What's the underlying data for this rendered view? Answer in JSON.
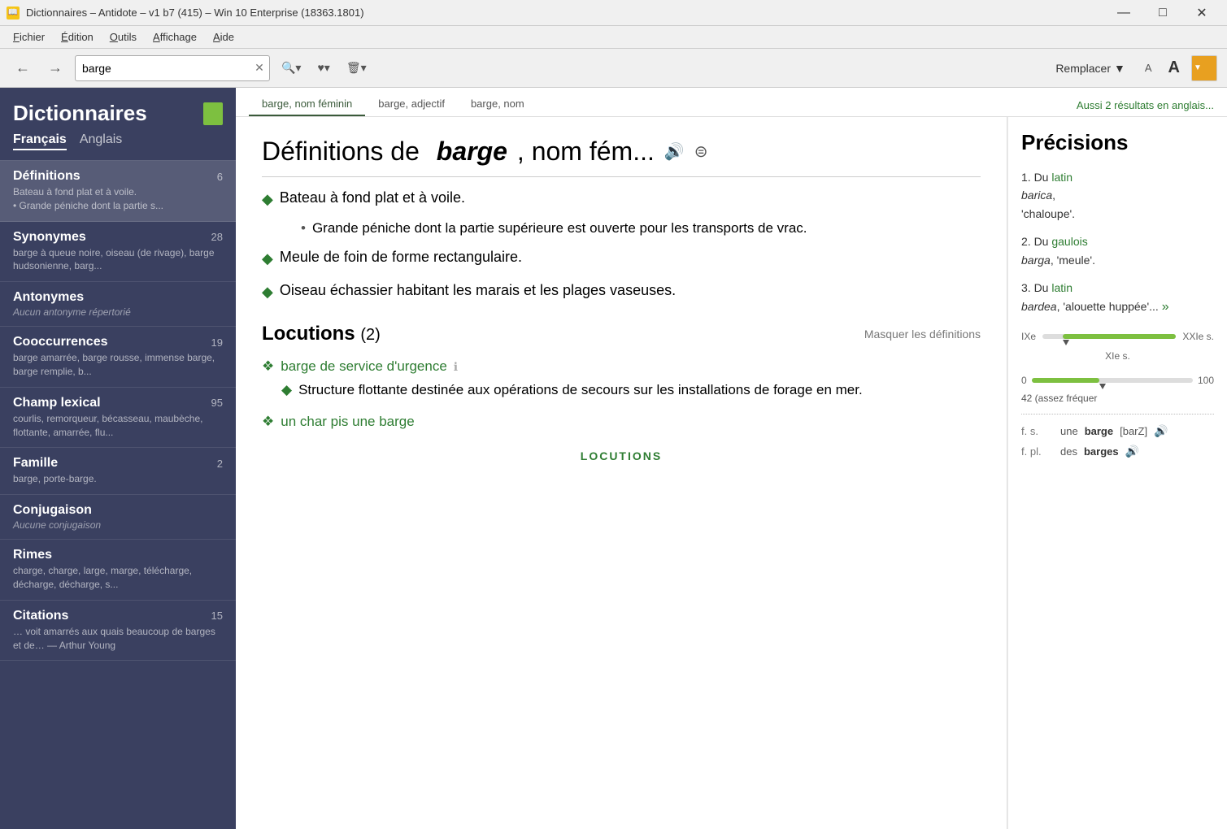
{
  "window": {
    "title": "Dictionnaires – Antidote – v1 b7 (415) – Win 10 Enterprise (18363.1801)",
    "icon": "📖"
  },
  "titlebar": {
    "minimize": "—",
    "maximize": "□",
    "close": "✕"
  },
  "menu": {
    "fichier": "Fichier",
    "edition": "Édition",
    "outils": "Outils",
    "affichage": "Affichage",
    "aide": "Aide"
  },
  "toolbar": {
    "back": "←",
    "forward": "→",
    "search_value": "barge",
    "search_clear": "✕",
    "search_icon": "🔍",
    "favorites_icon": "♥",
    "history_icon": "🗑",
    "remplacer": "Remplacer",
    "font_small": "A",
    "font_large": "A",
    "dropdown": "▼"
  },
  "sidebar": {
    "title": "Dictionnaires",
    "languages": [
      "Français",
      "Anglais"
    ],
    "active_language": "Français",
    "sections": [
      {
        "id": "definitions",
        "title": "Définitions",
        "count": 6,
        "preview": "Bateau à fond plat et à voile.\n• Grande péniche dont la partie s...",
        "active": true
      },
      {
        "id": "synonymes",
        "title": "Synonymes",
        "count": 28,
        "preview": "barge à queue noire, oiseau (de rivage), barge hudsonienne, barg..."
      },
      {
        "id": "antonymes",
        "title": "Antonymes",
        "count": null,
        "no_data": "Aucun antonyme répertorié"
      },
      {
        "id": "cooccurrences",
        "title": "Cooccurrences",
        "count": 19,
        "preview": "barge amarrée, barge rousse, immense barge, barge remplie, b..."
      },
      {
        "id": "champ_lexical",
        "title": "Champ lexical",
        "count": 95,
        "preview": "courlis, remorqueur, bécasseau, maubèche, flottante, amarrée, flu..."
      },
      {
        "id": "famille",
        "title": "Famille",
        "count": 2,
        "preview": "barge, porte-barge."
      },
      {
        "id": "conjugaison",
        "title": "Conjugaison",
        "count": null,
        "no_data": "Aucune conjugaison"
      },
      {
        "id": "rimes",
        "title": "Rimes",
        "count": null,
        "preview": "charge, charge, large, marge, télécharge, décharge, décharge, s..."
      },
      {
        "id": "citations",
        "title": "Citations",
        "count": 15,
        "preview": "… voit amarrés aux quais beaucoup de barges et de… — Arthur Young"
      }
    ]
  },
  "tabs": {
    "items": [
      {
        "label": "barge, nom féminin",
        "active": true
      },
      {
        "label": "barge, adjectif",
        "active": false
      },
      {
        "label": "barge, nom",
        "active": false
      }
    ],
    "english_results": "Aussi 2 résultats en anglais..."
  },
  "main_content": {
    "title_prefix": "Définitions de",
    "title_word": "barge",
    "title_suffix": ", nom fém...",
    "definitions": [
      {
        "bullet": "◆",
        "text": "Bateau à fond plat et à voile.",
        "sub": [
          {
            "bullet": "•",
            "text": "Grande péniche dont la partie supérieure est ouverte pour les transports de vrac."
          }
        ]
      },
      {
        "bullet": "◆",
        "text": "Meule de foin de forme rectangulaire.",
        "sub": []
      },
      {
        "bullet": "◆",
        "text": "Oiseau échassier habitant les marais et les plages vaseuses.",
        "sub": []
      }
    ],
    "locutions": {
      "title": "Locutions",
      "count": 2,
      "masquer": "Masquer les définitions",
      "items": [
        {
          "title": "barge de service d'urgence",
          "has_info": true,
          "definition": "Structure flottante destinée aux opérations de secours sur les installations de forage en mer."
        },
        {
          "title": "un char pis une barge",
          "has_info": false,
          "definition": null
        }
      ],
      "section_label": "LOCUTIONS"
    }
  },
  "precisions": {
    "title": "Précisions",
    "etymologies": [
      {
        "num": "1.",
        "intro": "Du",
        "lang": "latin",
        "word": "barica",
        "meaning": ", 'chaloupe'."
      },
      {
        "num": "2.",
        "intro": "Du",
        "lang": "gaulois",
        "word": "barga",
        "meaning": ", 'meule'."
      },
      {
        "num": "3.",
        "intro": "Du",
        "lang": "latin",
        "word": "bardea",
        "meaning": ", 'alouette huppée'...",
        "has_more": true
      }
    ],
    "timeline": {
      "start": "IXe",
      "end": "XXIe s.",
      "marker_label": "XIe s."
    },
    "frequency": {
      "label_left": "0",
      "label_right": "100",
      "value": 42,
      "value_label": "42 (assez fréquer"
    },
    "pronunciations": [
      {
        "label": "f. s.",
        "article": "une",
        "word": "barge",
        "ipa": "[barZ]"
      },
      {
        "label": "f. pl.",
        "article": "des",
        "word": "barge",
        "word_bold": "s"
      }
    ]
  }
}
